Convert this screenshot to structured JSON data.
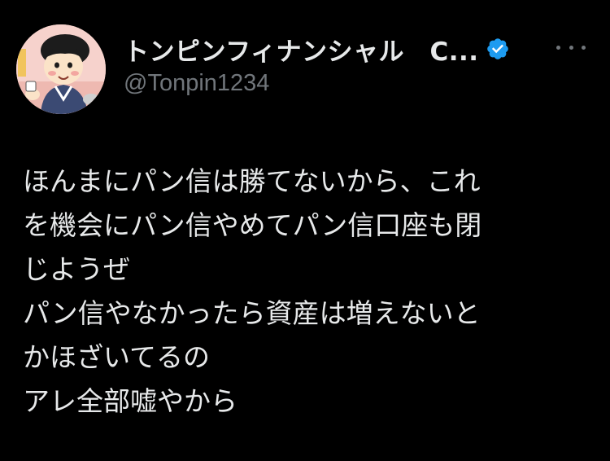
{
  "tweet": {
    "display_name": "トンピンフィナンシャル　C...",
    "handle": "@Tonpin1234",
    "verified": true,
    "verified_color": "#1d9bf0",
    "avatar_icon": "cartoon-character-avatar",
    "more_icon": "more-horizontal-icon",
    "lines": [
      "ほんまにパン信は勝てないから、これ",
      "を機会にパン信やめてパン信口座も閉",
      "じようぜ",
      "パン信やなかったら資産は増えないと",
      "かほざいてるの",
      "アレ全部嘘やから"
    ]
  }
}
